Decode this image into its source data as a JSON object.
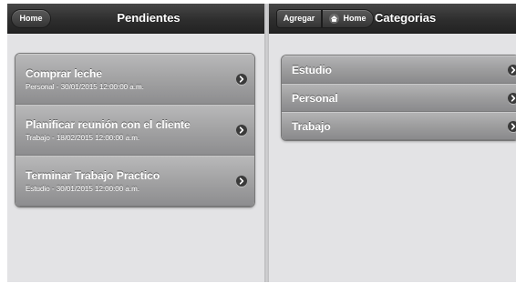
{
  "left_pane": {
    "header": {
      "title": "Pendientes",
      "home_button": "Home"
    },
    "items": [
      {
        "title": "Comprar leche",
        "subtitle": "Personal - 30/01/2015 12:00:00 a.m."
      },
      {
        "title": "Planificar reunión con el cliente",
        "subtitle": "Trabajo - 18/02/2015 12:00:00 a.m."
      },
      {
        "title": "Terminar Trabajo Practico",
        "subtitle": "Estudio - 30/01/2015 12:00:00 a.m."
      }
    ]
  },
  "right_pane": {
    "header": {
      "title": "Categorias",
      "add_button": "Agregar",
      "home_button": "Home"
    },
    "categories": [
      {
        "label": "Estudio"
      },
      {
        "label": "Personal"
      },
      {
        "label": "Trabajo"
      }
    ]
  },
  "icons": {
    "chevron": "chevron-right-icon",
    "home": "home-icon"
  },
  "colors": {
    "header_bg": "#2e2e2e",
    "panel_bg": "#e3e3e5",
    "item_bg": "#a2a2a3",
    "text": "#ffffff"
  }
}
